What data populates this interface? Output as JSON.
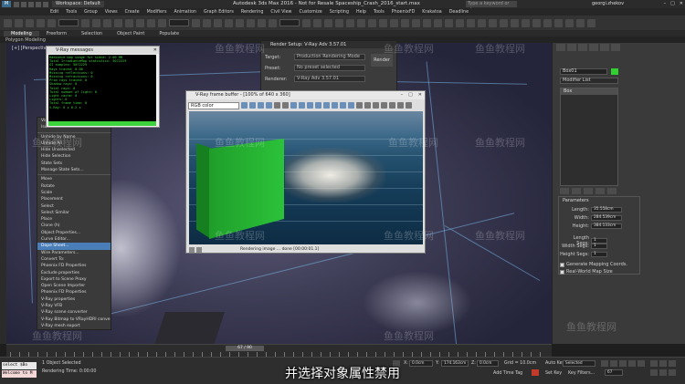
{
  "window": {
    "title": "Autodesk 3ds Max 2016 - Not for Resale   Spaceship_Crash_2016_start.max",
    "workspace": "Workspace: Default",
    "search_placeholder": "Type a keyword or phrase",
    "user": "georgi.zhekov"
  },
  "menu": [
    "Edit",
    "Tools",
    "Group",
    "Views",
    "Create",
    "Modifiers",
    "Animation",
    "Graph Editors",
    "Rendering",
    "Civil View",
    "Customize",
    "Scripting",
    "Help",
    "Tools",
    "PhoenixFD",
    "Krakatoa",
    "Deadline"
  ],
  "ribbon_tabs": [
    "Modeling",
    "Freeform",
    "Selection",
    "Object Paint",
    "Populate"
  ],
  "ribbon_sub": "Polygon Modeling",
  "viewport": {
    "label": "[+] [Perspective] [Realistic]"
  },
  "quad_menu": {
    "items": [
      "Viewport Lighting and Shadows",
      "Isolate Selection",
      "",
      "Unhide by Name",
      "Unhide All",
      "Hide Unselected",
      "Hide Selection",
      "State Sets",
      "Manage State Sets...",
      "",
      "Move",
      "Rotate",
      "Scale",
      "Placement",
      "Select",
      "Select Similar",
      "Place",
      "Clone (h)",
      "Object Properties...",
      "Curve Editor...",
      "Dope Sheet...",
      "Wire Parameters...",
      "Convert To:",
      "Phoenix FD Properties",
      "Exclude properties",
      "Export to Scene Proxy",
      "Open Scene Importer",
      "Phoenix FD Properties",
      "V-Ray properties",
      "V-Ray VFB",
      "V-Ray scene converter",
      "V-Ray Bitmap to VRayHDRI converter",
      "V-Ray mesh export"
    ],
    "highlighted_index": 20,
    "highlighted_label": "Dope Sheet..."
  },
  "vray_messages": {
    "title": "V-Ray messages",
    "lines": [
      "Radiance map usage for scene: 2.00 MB",
      "Total IrradianceMap statistics: 5072229",
      "  GI samples: 5072229",
      "  Rays traced: 0.00",
      "  Missing reflections: 0",
      "  Missing refractions: 0",
      "  Prim rays traced: 0",
      "  Shadow rays: 0",
      "  Total rays: 0",
      "  Total number of light: 0",
      "  Light cache: 0",
      "  Lights: 0",
      "  Total frame time: 0",
      "V-Ray: 0 s 0.2 s"
    ]
  },
  "render_setup": {
    "title": "Render Setup: V-Ray Adv 3.57.01",
    "rows": [
      {
        "label": "Target:",
        "value": "Production Rendering Mode"
      },
      {
        "label": "Preset:",
        "value": "No preset selected"
      },
      {
        "label": "Renderer:",
        "value": "V-Ray Adv 3.57.01"
      }
    ],
    "render_button": "Render"
  },
  "vfb": {
    "title": "V-Ray frame buffer - [100% of 640 x 360]",
    "channel": "RGB color",
    "status": "Rendering image ... done [00:00:01.1]"
  },
  "command_panel": {
    "name": "Box01",
    "modifier_list": "Modifier List",
    "stack": [
      "Box"
    ],
    "rollout_title": "Parameters",
    "params": [
      {
        "label": "Length:",
        "value": "35.558cm"
      },
      {
        "label": "Width:",
        "value": "284.539cm"
      },
      {
        "label": "Height:",
        "value": "384.133cm"
      },
      {
        "label": "Length Segs:",
        "value": "1"
      },
      {
        "label": "Width Segs:",
        "value": "1"
      },
      {
        "label": "Height Segs:",
        "value": "1"
      }
    ],
    "checks": [
      "Generate Mapping Coords.",
      "Real-World Map Size"
    ],
    "colors": {
      "object_swatch": "#2fd02f"
    }
  },
  "timeline": {
    "slider": "67 / 90",
    "end_label": "90"
  },
  "statusbar": {
    "listener1": "select $Bo",
    "listener2": "Welcome to M",
    "selected": "1 Object Selected",
    "render_time": "Rendering Time: 0:00:00",
    "x_label": "X:",
    "x_val": "0.0cm",
    "y_label": "Y:",
    "y_val": "174.163cm",
    "z_label": "Z:",
    "z_val": "0.0cm",
    "grid": "Grid = 10.0cm",
    "add_time_tag": "Add Time Tag",
    "autokey": "Auto Key",
    "autokey_mode": "Selected",
    "set_key": "Set Key",
    "key_filters": "Key Filters...",
    "frame": "67"
  },
  "subtitle": "并选择对象属性禁用",
  "watermark": "鱼鱼教程网"
}
